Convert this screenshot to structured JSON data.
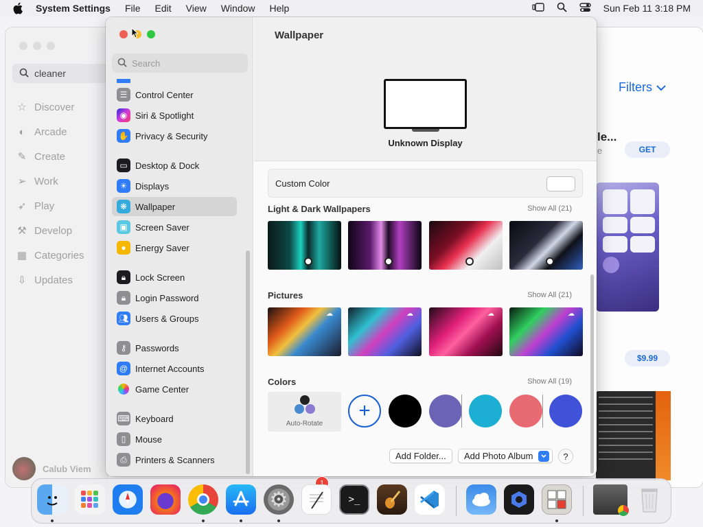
{
  "menubar": {
    "app_name": "System Settings",
    "menus": [
      "File",
      "Edit",
      "View",
      "Window",
      "Help"
    ],
    "datetime": "Sun Feb 11  3:18 PM"
  },
  "background_app": {
    "search_value": "cleaner",
    "nav": [
      "Discover",
      "Arcade",
      "Create",
      "Work",
      "Play",
      "Develop",
      "Categories",
      "Updates"
    ],
    "user_name": "Calub Viem",
    "filters_label": "Filters",
    "result_title_fragment": "le...",
    "result_sub_fragment": "e",
    "get_label": "GET",
    "price_label": "$9.99"
  },
  "settings": {
    "search_placeholder": "Search",
    "sidebar_items": [
      {
        "label": "Control Center",
        "icon": "control-center-icon",
        "color": "#8e8e93"
      },
      {
        "label": "Siri & Spotlight",
        "icon": "siri-icon",
        "color": "#c33bd9"
      },
      {
        "label": "Privacy & Security",
        "icon": "hand-icon",
        "color": "#2f7cf6"
      },
      {
        "label": "Desktop & Dock",
        "icon": "dock-icon",
        "color": "#1c1c1e"
      },
      {
        "label": "Displays",
        "icon": "sun-icon",
        "color": "#2f7cf6"
      },
      {
        "label": "Wallpaper",
        "icon": "flower-icon",
        "color": "#35aadc"
      },
      {
        "label": "Screen Saver",
        "icon": "screen-saver-icon",
        "color": "#5ac8e0"
      },
      {
        "label": "Energy Saver",
        "icon": "lightbulb-icon",
        "color": "#f5b700"
      },
      {
        "label": "Lock Screen",
        "icon": "lock-icon",
        "color": "#1c1c1e"
      },
      {
        "label": "Login Password",
        "icon": "lock-icon",
        "color": "#8e8e93"
      },
      {
        "label": "Users & Groups",
        "icon": "users-icon",
        "color": "#2f7cf6"
      },
      {
        "label": "Passwords",
        "icon": "key-icon",
        "color": "#8e8e93"
      },
      {
        "label": "Internet Accounts",
        "icon": "at-icon",
        "color": "#2f7cf6"
      },
      {
        "label": "Game Center",
        "icon": "game-center-icon",
        "color": "#ffffff"
      },
      {
        "label": "Keyboard",
        "icon": "keyboard-icon",
        "color": "#8e8e93"
      },
      {
        "label": "Mouse",
        "icon": "mouse-icon",
        "color": "#8e8e93"
      },
      {
        "label": "Printers & Scanners",
        "icon": "printer-icon",
        "color": "#8e8e93"
      }
    ],
    "selected": "Wallpaper",
    "page_title": "Wallpaper",
    "display_name": "Unknown Display",
    "custom_color_label": "Custom Color",
    "sections": {
      "light_dark": {
        "title": "Light & Dark Wallpapers",
        "show_all": "Show All (21)"
      },
      "pictures": {
        "title": "Pictures",
        "show_all": "Show All (21)"
      },
      "colors": {
        "title": "Colors",
        "show_all": "Show All (19)"
      }
    },
    "auto_rotate_label": "Auto-Rotate",
    "colors": [
      "#000000",
      "#6b63b5",
      "#1cafd3",
      "#e86a72",
      "#3f52d8"
    ],
    "buttons": {
      "add_folder": "Add Folder...",
      "add_photo_album": "Add Photo Album",
      "help": "?"
    }
  },
  "dock": {
    "apps": [
      "Finder",
      "Launchpad",
      "Safari",
      "Firefox",
      "Chrome",
      "App Store",
      "System Settings",
      "TextEdit",
      "Terminal",
      "GarageBand",
      "Visual Studio Code",
      "Weather",
      "Screenium",
      "Puzzle",
      "Preview",
      "Trash"
    ],
    "settings_badge": "1"
  }
}
